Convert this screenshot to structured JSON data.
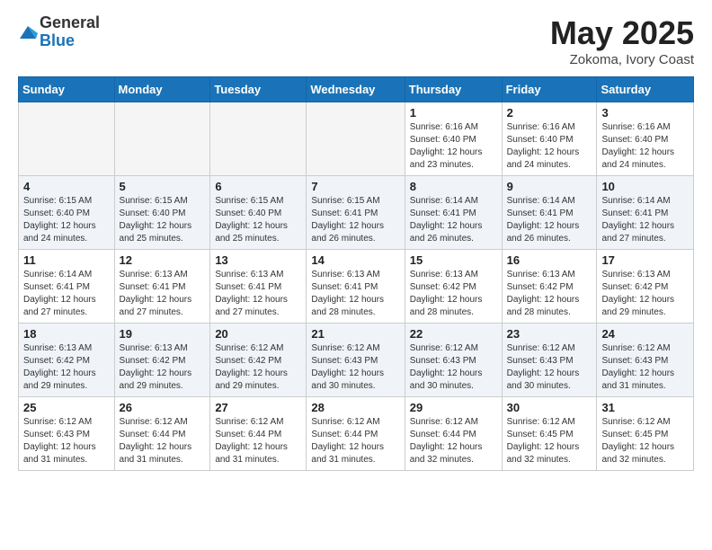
{
  "logo": {
    "general": "General",
    "blue": "Blue"
  },
  "title": {
    "month": "May 2025",
    "location": "Zokoma, Ivory Coast"
  },
  "weekdays": [
    "Sunday",
    "Monday",
    "Tuesday",
    "Wednesday",
    "Thursday",
    "Friday",
    "Saturday"
  ],
  "weeks": [
    [
      {
        "day": "",
        "info": ""
      },
      {
        "day": "",
        "info": ""
      },
      {
        "day": "",
        "info": ""
      },
      {
        "day": "",
        "info": ""
      },
      {
        "day": "1",
        "info": "Sunrise: 6:16 AM\nSunset: 6:40 PM\nDaylight: 12 hours and 23 minutes."
      },
      {
        "day": "2",
        "info": "Sunrise: 6:16 AM\nSunset: 6:40 PM\nDaylight: 12 hours and 24 minutes."
      },
      {
        "day": "3",
        "info": "Sunrise: 6:16 AM\nSunset: 6:40 PM\nDaylight: 12 hours and 24 minutes."
      }
    ],
    [
      {
        "day": "4",
        "info": "Sunrise: 6:15 AM\nSunset: 6:40 PM\nDaylight: 12 hours and 24 minutes."
      },
      {
        "day": "5",
        "info": "Sunrise: 6:15 AM\nSunset: 6:40 PM\nDaylight: 12 hours and 25 minutes."
      },
      {
        "day": "6",
        "info": "Sunrise: 6:15 AM\nSunset: 6:40 PM\nDaylight: 12 hours and 25 minutes."
      },
      {
        "day": "7",
        "info": "Sunrise: 6:15 AM\nSunset: 6:41 PM\nDaylight: 12 hours and 26 minutes."
      },
      {
        "day": "8",
        "info": "Sunrise: 6:14 AM\nSunset: 6:41 PM\nDaylight: 12 hours and 26 minutes."
      },
      {
        "day": "9",
        "info": "Sunrise: 6:14 AM\nSunset: 6:41 PM\nDaylight: 12 hours and 26 minutes."
      },
      {
        "day": "10",
        "info": "Sunrise: 6:14 AM\nSunset: 6:41 PM\nDaylight: 12 hours and 27 minutes."
      }
    ],
    [
      {
        "day": "11",
        "info": "Sunrise: 6:14 AM\nSunset: 6:41 PM\nDaylight: 12 hours and 27 minutes."
      },
      {
        "day": "12",
        "info": "Sunrise: 6:13 AM\nSunset: 6:41 PM\nDaylight: 12 hours and 27 minutes."
      },
      {
        "day": "13",
        "info": "Sunrise: 6:13 AM\nSunset: 6:41 PM\nDaylight: 12 hours and 27 minutes."
      },
      {
        "day": "14",
        "info": "Sunrise: 6:13 AM\nSunset: 6:41 PM\nDaylight: 12 hours and 28 minutes."
      },
      {
        "day": "15",
        "info": "Sunrise: 6:13 AM\nSunset: 6:42 PM\nDaylight: 12 hours and 28 minutes."
      },
      {
        "day": "16",
        "info": "Sunrise: 6:13 AM\nSunset: 6:42 PM\nDaylight: 12 hours and 28 minutes."
      },
      {
        "day": "17",
        "info": "Sunrise: 6:13 AM\nSunset: 6:42 PM\nDaylight: 12 hours and 29 minutes."
      }
    ],
    [
      {
        "day": "18",
        "info": "Sunrise: 6:13 AM\nSunset: 6:42 PM\nDaylight: 12 hours and 29 minutes."
      },
      {
        "day": "19",
        "info": "Sunrise: 6:13 AM\nSunset: 6:42 PM\nDaylight: 12 hours and 29 minutes."
      },
      {
        "day": "20",
        "info": "Sunrise: 6:12 AM\nSunset: 6:42 PM\nDaylight: 12 hours and 29 minutes."
      },
      {
        "day": "21",
        "info": "Sunrise: 6:12 AM\nSunset: 6:43 PM\nDaylight: 12 hours and 30 minutes."
      },
      {
        "day": "22",
        "info": "Sunrise: 6:12 AM\nSunset: 6:43 PM\nDaylight: 12 hours and 30 minutes."
      },
      {
        "day": "23",
        "info": "Sunrise: 6:12 AM\nSunset: 6:43 PM\nDaylight: 12 hours and 30 minutes."
      },
      {
        "day": "24",
        "info": "Sunrise: 6:12 AM\nSunset: 6:43 PM\nDaylight: 12 hours and 31 minutes."
      }
    ],
    [
      {
        "day": "25",
        "info": "Sunrise: 6:12 AM\nSunset: 6:43 PM\nDaylight: 12 hours and 31 minutes."
      },
      {
        "day": "26",
        "info": "Sunrise: 6:12 AM\nSunset: 6:44 PM\nDaylight: 12 hours and 31 minutes."
      },
      {
        "day": "27",
        "info": "Sunrise: 6:12 AM\nSunset: 6:44 PM\nDaylight: 12 hours and 31 minutes."
      },
      {
        "day": "28",
        "info": "Sunrise: 6:12 AM\nSunset: 6:44 PM\nDaylight: 12 hours and 31 minutes."
      },
      {
        "day": "29",
        "info": "Sunrise: 6:12 AM\nSunset: 6:44 PM\nDaylight: 12 hours and 32 minutes."
      },
      {
        "day": "30",
        "info": "Sunrise: 6:12 AM\nSunset: 6:45 PM\nDaylight: 12 hours and 32 minutes."
      },
      {
        "day": "31",
        "info": "Sunrise: 6:12 AM\nSunset: 6:45 PM\nDaylight: 12 hours and 32 minutes."
      }
    ]
  ]
}
